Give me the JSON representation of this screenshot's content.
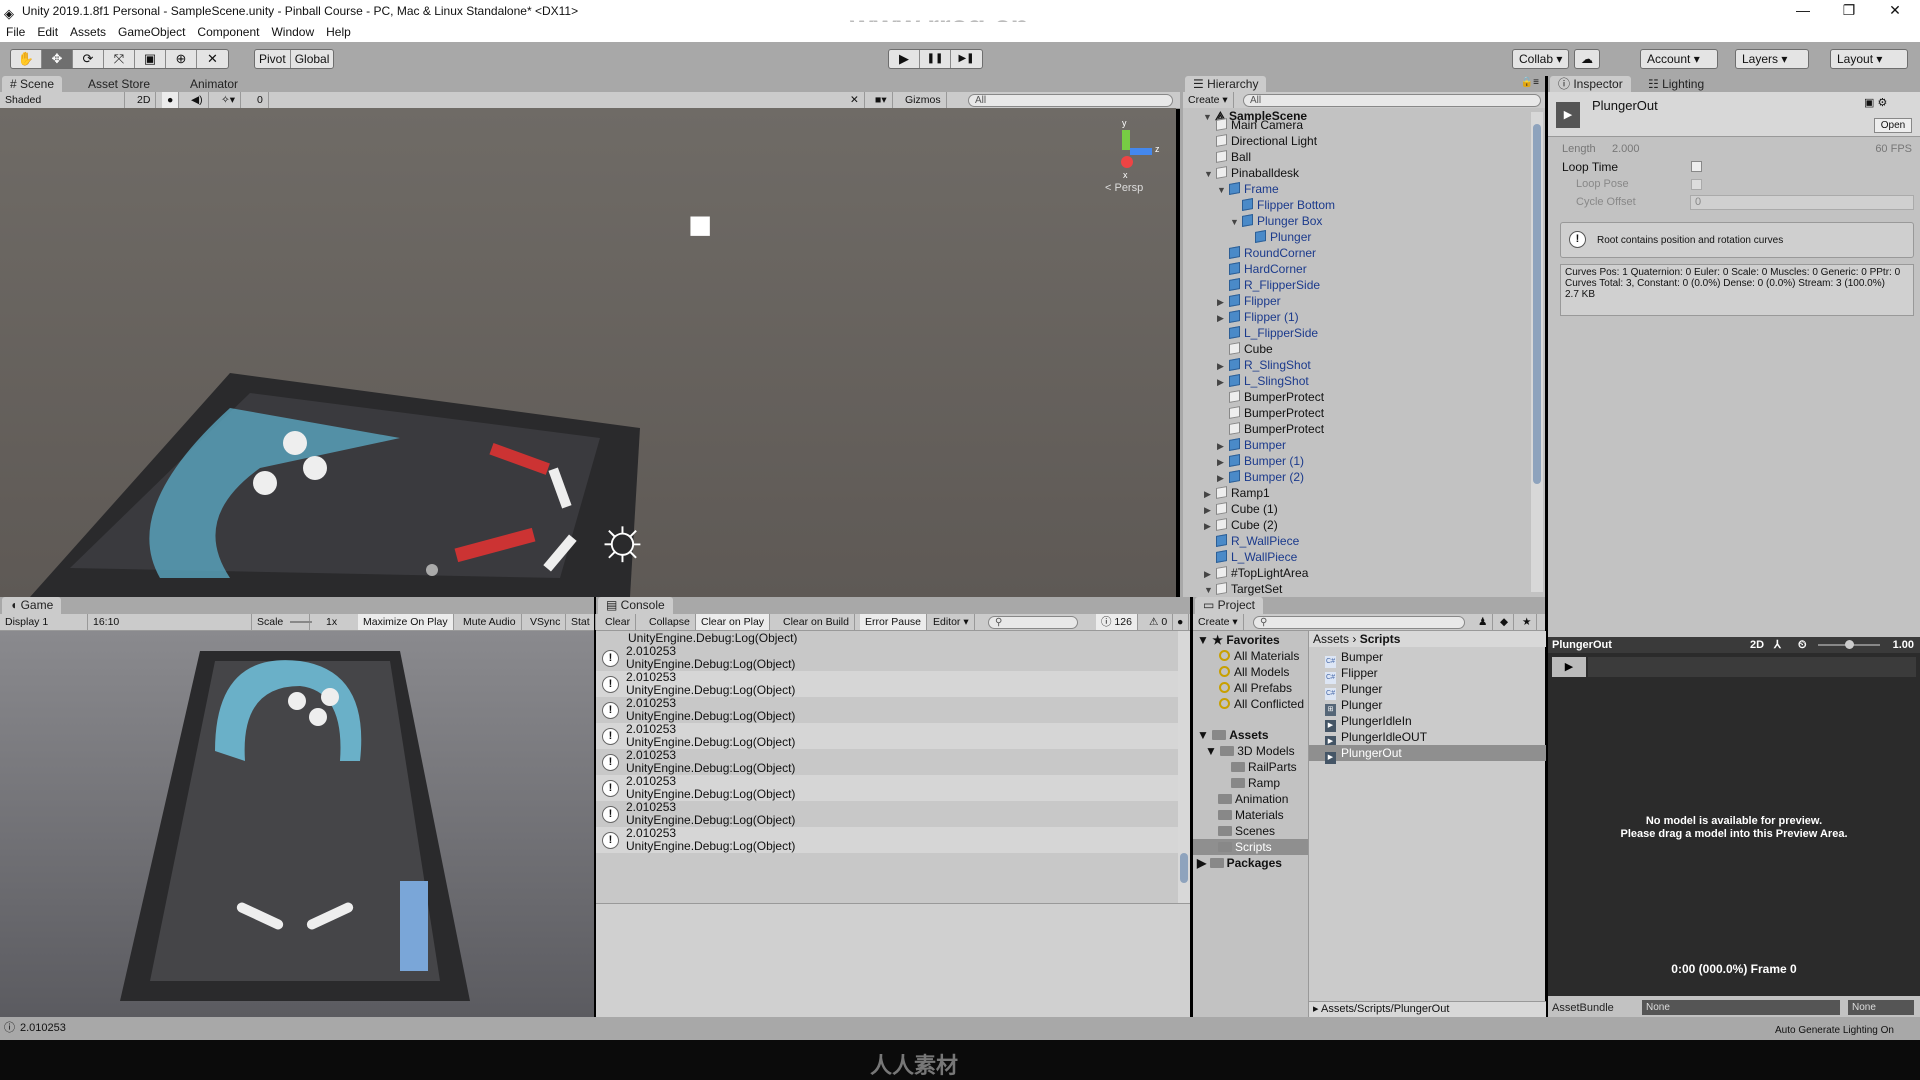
{
  "window": {
    "title": "Unity 2019.1.8f1 Personal - SampleScene.unity - Pinball Course - PC, Mac & Linux Standalone* <DX11>",
    "minimize": "—",
    "maximize": "❐",
    "close": "✕"
  },
  "menu": [
    "File",
    "Edit",
    "Assets",
    "GameObject",
    "Component",
    "Window",
    "Help"
  ],
  "toolbar": {
    "tools": [
      "✋",
      "✥",
      "⟳",
      "⤧",
      "▣",
      "⊕",
      "✕"
    ],
    "pivot": "Pivot",
    "global": "Global",
    "play": "▶",
    "pause": "❚❚",
    "step": "▶❚",
    "collab": "Collab ▾",
    "cloud": "☁",
    "account": "Account ▾",
    "layers": "Layers ▾",
    "layout": "Layout ▾"
  },
  "scene": {
    "tabs": [
      "# Scene",
      "Asset Store",
      "Animator"
    ],
    "shading": "Shaded",
    "mode2d": "2D",
    "hidden_count": "0",
    "gizmos": "Gizmos",
    "search_placeholder": "All",
    "persp": "< Persp",
    "axes": {
      "y": "y",
      "z": "z",
      "x": "x"
    }
  },
  "hierarchy": {
    "tab": "Hierarchy",
    "create": "Create ▾",
    "search_placeholder": "All",
    "scene": "SampleScene",
    "items": [
      {
        "label": "Main Camera",
        "depth": 1,
        "arrow": "",
        "prefab": false
      },
      {
        "label": "Directional Light",
        "depth": 1,
        "arrow": "",
        "prefab": false
      },
      {
        "label": "Ball",
        "depth": 1,
        "arrow": "",
        "prefab": false
      },
      {
        "label": "Pinaballdesk",
        "depth": 1,
        "arrow": "▼",
        "prefab": false
      },
      {
        "label": "Frame",
        "depth": 2,
        "arrow": "▼",
        "prefab": true
      },
      {
        "label": "Flipper Bottom",
        "depth": 3,
        "arrow": "",
        "prefab": true
      },
      {
        "label": "Plunger Box",
        "depth": 3,
        "arrow": "▼",
        "prefab": true
      },
      {
        "label": "Plunger",
        "depth": 4,
        "arrow": "",
        "prefab": true
      },
      {
        "label": "RoundCorner",
        "depth": 2,
        "arrow": "",
        "prefab": true
      },
      {
        "label": "HardCorner",
        "depth": 2,
        "arrow": "",
        "prefab": true
      },
      {
        "label": "R_FlipperSide",
        "depth": 2,
        "arrow": "",
        "prefab": true
      },
      {
        "label": "Flipper",
        "depth": 2,
        "arrow": "▶",
        "prefab": true
      },
      {
        "label": "Flipper (1)",
        "depth": 2,
        "arrow": "▶",
        "prefab": true
      },
      {
        "label": "L_FlipperSide",
        "depth": 2,
        "arrow": "",
        "prefab": true
      },
      {
        "label": "Cube",
        "depth": 2,
        "arrow": "",
        "prefab": false
      },
      {
        "label": "R_SlingShot",
        "depth": 2,
        "arrow": "▶",
        "prefab": true
      },
      {
        "label": "L_SlingShot",
        "depth": 2,
        "arrow": "▶",
        "prefab": true
      },
      {
        "label": "BumperProtect",
        "depth": 2,
        "arrow": "",
        "prefab": false
      },
      {
        "label": "BumperProtect",
        "depth": 2,
        "arrow": "",
        "prefab": false
      },
      {
        "label": "BumperProtect",
        "depth": 2,
        "arrow": "",
        "prefab": false
      },
      {
        "label": "Bumper",
        "depth": 2,
        "arrow": "▶",
        "prefab": true
      },
      {
        "label": "Bumper (1)",
        "depth": 2,
        "arrow": "▶",
        "prefab": true
      },
      {
        "label": "Bumper (2)",
        "depth": 2,
        "arrow": "▶",
        "prefab": true
      },
      {
        "label": "Ramp1",
        "depth": 1,
        "arrow": "▶",
        "prefab": false
      },
      {
        "label": "Cube (1)",
        "depth": 1,
        "arrow": "▶",
        "prefab": false
      },
      {
        "label": "Cube (2)",
        "depth": 1,
        "arrow": "▶",
        "prefab": false
      },
      {
        "label": "R_WallPiece",
        "depth": 1,
        "arrow": "",
        "prefab": true
      },
      {
        "label": "L_WallPiece",
        "depth": 1,
        "arrow": "",
        "prefab": true
      },
      {
        "label": "#TopLightArea",
        "depth": 1,
        "arrow": "▶",
        "prefab": false
      },
      {
        "label": "TargetSet",
        "depth": 1,
        "arrow": "▼",
        "prefab": false
      }
    ]
  },
  "inspector": {
    "tabs": [
      "Inspector",
      "Lighting"
    ],
    "asset_name": "PlungerOut",
    "open": "Open",
    "length_label": "Length",
    "length_value": "2.000",
    "fps": "60 FPS",
    "loop_time": "Loop Time",
    "loop_time_checked": false,
    "loop_pose": "Loop Pose",
    "loop_pose_checked": false,
    "cycle_offset": "Cycle Offset",
    "cycle_offset_value": "0",
    "warning": "Root contains position and rotation curves",
    "info": [
      "Curves Pos: 1 Quaternion: 0 Euler: 0 Scale: 0 Muscles: 0 Generic: 0 PPtr: 0",
      "Curves Total: 3, Constant: 0 (0.0%) Dense: 0 (0.0%) Stream: 3 (100.0%)",
      "2.7 KB"
    ]
  },
  "preview": {
    "name": "PlungerOut",
    "mode2d": "2D",
    "speed": "1.00",
    "speed_level": 0.5,
    "message_1": "No model is available for preview.",
    "message_2": "Please drag a model into this Preview Area.",
    "time": "0:00 (000.0%) Frame 0",
    "assetbundle_label": "AssetBundle",
    "assetbundle_value": "None",
    "variant_value": "None"
  },
  "game": {
    "tab": "Game",
    "display": "Display 1",
    "aspect": "16:10",
    "scale_label": "Scale",
    "scale_value": "1x",
    "buttons": [
      "Maximize On Play",
      "Mute Audio",
      "VSync",
      "Stat"
    ]
  },
  "console": {
    "tab": "Console",
    "buttons": [
      "Clear",
      "Collapse",
      "Clear on Play",
      "Clear on Build",
      "Error Pause",
      "Editor ▾"
    ],
    "log_count": "126",
    "warn_count": "0",
    "partial_top": "UnityEngine.Debug:Log(Object)",
    "entries": [
      {
        "value": "2.010253",
        "trace": "UnityEngine.Debug:Log(Object)"
      },
      {
        "value": "2.010253",
        "trace": "UnityEngine.Debug:Log(Object)"
      },
      {
        "value": "2.010253",
        "trace": "UnityEngine.Debug:Log(Object)"
      },
      {
        "value": "2.010253",
        "trace": "UnityEngine.Debug:Log(Object)"
      },
      {
        "value": "2.010253",
        "trace": "UnityEngine.Debug:Log(Object)"
      },
      {
        "value": "2.010253",
        "trace": "UnityEngine.Debug:Log(Object)"
      },
      {
        "value": "2.010253",
        "trace": "UnityEngine.Debug:Log(Object)"
      },
      {
        "value": "2.010253",
        "trace": "UnityEngine.Debug:Log(Object)"
      }
    ]
  },
  "project": {
    "tab": "Project",
    "create": "Create ▾",
    "favorites": "Favorites",
    "favorite_items": [
      "All Materials",
      "All Models",
      "All Prefabs",
      "All Conflicted"
    ],
    "assets": "Assets",
    "folders": [
      {
        "label": "3D Models",
        "depth": 1
      },
      {
        "label": "RailParts",
        "depth": 2
      },
      {
        "label": "Ramp",
        "depth": 2
      },
      {
        "label": "Animation",
        "depth": 1
      },
      {
        "label": "Materials",
        "depth": 1
      },
      {
        "label": "Scenes",
        "depth": 1
      },
      {
        "label": "Scripts",
        "depth": 1
      }
    ],
    "packages": "Packages",
    "breadcrumb": [
      "Assets",
      "Scripts"
    ],
    "files": [
      {
        "label": "Bumper",
        "type": "script"
      },
      {
        "label": "Flipper",
        "type": "script"
      },
      {
        "label": "Plunger",
        "type": "script"
      },
      {
        "label": "Plunger",
        "type": "controller"
      },
      {
        "label": "PlungerIdleIn",
        "type": "anim"
      },
      {
        "label": "PlungerIdleOUT",
        "type": "anim"
      },
      {
        "label": "PlungerOut",
        "type": "anim"
      }
    ],
    "selected_file": "PlungerOut",
    "selected_folder": "Scripts",
    "path": "Assets/Scripts/PlungerOut"
  },
  "status": {
    "message": "2.010253",
    "lighting": "Auto Generate Lighting On"
  },
  "watermark": {
    "top": "www.rrcg.cn",
    "bottom": "人人素材"
  },
  "colors": {
    "prefab_text": "#1b3a8c",
    "selection": "#8f8f8f",
    "toolbar": "#a8a8a8",
    "panel": "#c2c2c2",
    "preview_bg": "#2b2b2b"
  }
}
